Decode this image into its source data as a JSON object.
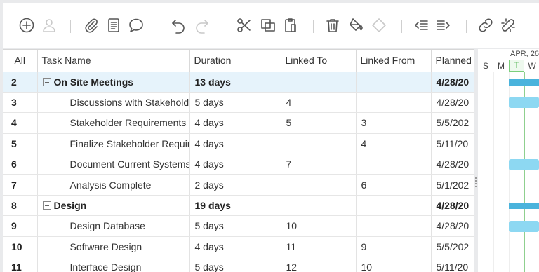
{
  "toolbar": {
    "icons": [
      "add-icon",
      "user-icon",
      "attachment-icon",
      "notes-icon",
      "comment-icon",
      "undo-icon",
      "redo-icon",
      "cut-icon",
      "copy-icon",
      "paste-icon",
      "delete-icon",
      "fill-color-icon",
      "milestone-icon",
      "outdent-icon",
      "indent-icon",
      "link-icon",
      "unlink-icon"
    ]
  },
  "grid": {
    "columns": [
      "All",
      "Task Name",
      "Duration",
      "Linked To",
      "Linked From",
      "Planned"
    ],
    "rows": [
      {
        "num": "2",
        "name": "On Site Meetings",
        "duration": "13 days",
        "linked_to": "",
        "linked_from": "",
        "planned": "4/28/20",
        "summary": true
      },
      {
        "num": "3",
        "name": "Discussions with Stakeholders",
        "duration": "5 days",
        "linked_to": "4",
        "linked_from": "",
        "planned": "4/28/20",
        "summary": false
      },
      {
        "num": "4",
        "name": "Stakeholder Requirements",
        "duration": "4 days",
        "linked_to": "5",
        "linked_from": "3",
        "planned": "5/5/202",
        "summary": false
      },
      {
        "num": "5",
        "name": "Finalize Stakeholder Requirements",
        "duration": "4 days",
        "linked_to": "",
        "linked_from": "4",
        "planned": "5/11/20",
        "summary": false
      },
      {
        "num": "6",
        "name": "Document Current Systems",
        "duration": "4 days",
        "linked_to": "7",
        "linked_from": "",
        "planned": "4/28/20",
        "summary": false
      },
      {
        "num": "7",
        "name": "Analysis Complete",
        "duration": "2 days",
        "linked_to": "",
        "linked_from": "6",
        "planned": "5/1/202",
        "summary": false
      },
      {
        "num": "8",
        "name": "Design",
        "duration": "19 days",
        "linked_to": "",
        "linked_from": "",
        "planned": "4/28/20",
        "summary": true
      },
      {
        "num": "9",
        "name": "Design Database",
        "duration": "5 days",
        "linked_to": "10",
        "linked_from": "",
        "planned": "4/28/20",
        "summary": false
      },
      {
        "num": "10",
        "name": "Software Design",
        "duration": "4 days",
        "linked_to": "11",
        "linked_from": "9",
        "planned": "5/5/202",
        "summary": false
      },
      {
        "num": "11",
        "name": "Interface Design",
        "duration": "5 days",
        "linked_to": "12",
        "linked_from": "10",
        "planned": "5/11/20",
        "summary": false
      }
    ]
  },
  "gantt": {
    "week_label": "APR, 26",
    "days": [
      "S",
      "M",
      "T",
      "W"
    ],
    "today": "T",
    "colors": {
      "bar": "#8dd8f2",
      "summary": "#4ab3dc",
      "today": "#5cb85c",
      "selected_row": "#e6f3fb"
    }
  }
}
